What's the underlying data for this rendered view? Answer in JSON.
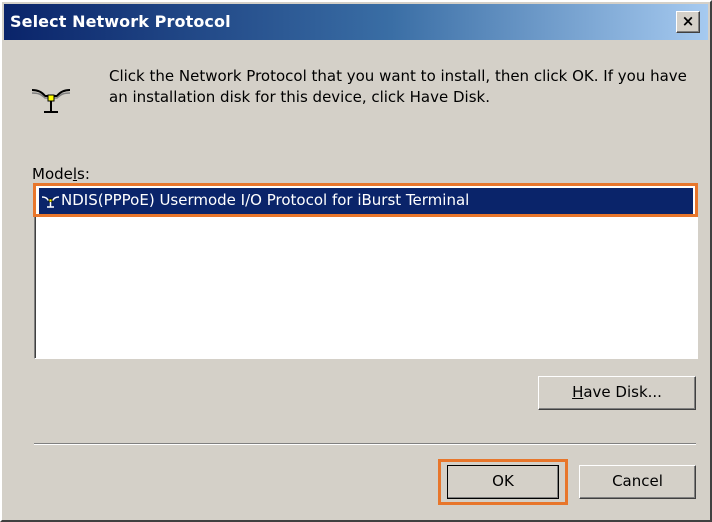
{
  "dialog": {
    "title": "Select Network Protocol",
    "close_symbol": "×",
    "instructions": "Click the Network Protocol that you want to install, then click OK. If you have an installation disk for this device, click Have Disk.",
    "icon": "network-protocol-icon"
  },
  "models": {
    "label_pre": "Mode",
    "label_mnemonic": "l",
    "label_post": "s:",
    "items": [
      {
        "label": "NDIS(PPPoE) Usermode I/O Protocol for iBurst Terminal",
        "icon": "network-protocol-icon",
        "selected": true
      }
    ]
  },
  "buttons": {
    "have_disk_mnemonic": "H",
    "have_disk_rest": "ave Disk...",
    "ok": "OK",
    "cancel": "Cancel"
  },
  "colors": {
    "highlight": "#e8762b",
    "selection": "#0a246a",
    "titlebar_start": "#0a246a",
    "titlebar_end": "#a6caf0",
    "face": "#d4d0c8"
  }
}
